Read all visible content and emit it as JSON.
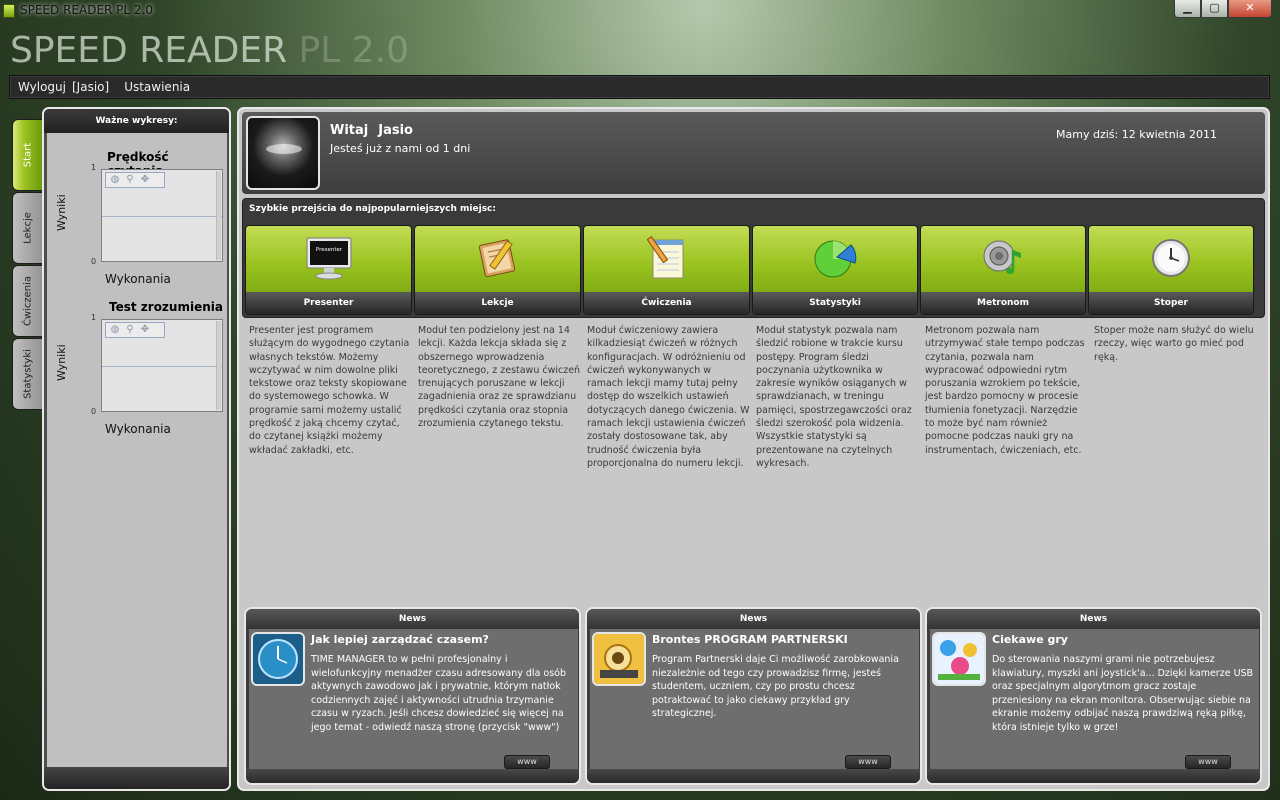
{
  "window": {
    "title": "SPEED READER PL 2.0",
    "controls": {
      "minimize": "▁",
      "maximize": "▢",
      "close": "✕"
    }
  },
  "brand": {
    "main": "SPEED READER",
    "version": "PL 2.0"
  },
  "menu": {
    "items": [
      "Wyloguj",
      "[Jasio]",
      "Ustawienia"
    ]
  },
  "side_tabs": [
    {
      "label": "Start",
      "active": true
    },
    {
      "label": "Lekcje",
      "active": false
    },
    {
      "label": "Ćwiczenia",
      "active": false
    },
    {
      "label": "Statystyki",
      "active": false
    }
  ],
  "left_panel": {
    "header": "Ważne wykresy:",
    "charts": [
      {
        "title": "Prędkość czytania",
        "ylabel": "Wyniki",
        "xlabel": "Wykonania",
        "y_ticks": [
          "1",
          "0"
        ]
      },
      {
        "title": "Test zrozumienia",
        "ylabel": "Wyniki",
        "xlabel": "Wykonania",
        "y_ticks": [
          "1",
          "0"
        ]
      }
    ]
  },
  "welcome": {
    "greeting": "Witaj",
    "user": "Jasio",
    "since": "Jesteś już z nami od 1 dni",
    "today": "Mamy dziś: 12 kwietnia 2011"
  },
  "quick": {
    "label": "Szybkie przejścia do najpopularniejszych miejsc:",
    "tiles": [
      {
        "name": "Presenter",
        "icon": "monitor-icon",
        "screen_text": "Presenter",
        "desc": "Presenter jest programem służącym do wygodnego czytania własnych tekstów. Możemy wczytywać w nim dowolne pliki tekstowe oraz teksty skopiowane do systemowego schowka. W programie sami możemy ustalić prędkość z jaką chcemy czytać, do czytanej książki możemy wkładać zakładki, etc."
      },
      {
        "name": "Lekcje",
        "icon": "book-pencil-icon",
        "desc": "Moduł ten podzielony jest na 14 lekcji. Każda lekcja składa się z obszernego wprowadzenia teoretycznego, z zestawu ćwiczeń trenujących poruszane w lekcji zagadnienia oraz ze sprawdzianu prędkości czytania oraz stopnia zrozumienia czytanego tekstu."
      },
      {
        "name": "Ćwiczenia",
        "icon": "notepad-icon",
        "desc": "Moduł ćwiczeniowy zawiera kilkadziesiąt ćwiczeń w różnych konfiguracjach. W odróżnieniu od ćwiczeń wykonywanych w ramach lekcji mamy tutaj pełny dostęp do wszelkich ustawień dotyczących danego ćwiczenia. W ramach lekcji ustawienia ćwiczeń zostały dostosowane tak, aby trudność ćwiczenia była proporcjonalna do numeru lekcji."
      },
      {
        "name": "Statystyki",
        "icon": "pie-chart-icon",
        "desc": "Moduł statystyk pozwala nam śledzić robione w trakcie kursu postępy. Program śledzi poczynania użytkownika w zakresie wyników osiąganych w sprawdzianach, w treningu pamięci, spostrzegawczości oraz śledzi szerokość pola widzenia. Wszystkie statystyki są prezentowane na czytelnych wykresach."
      },
      {
        "name": "Metronom",
        "icon": "speaker-note-icon",
        "desc": "Metronom pozwala nam utrzymywać stałe tempo podczas czytania, pozwala nam wypracować odpowiedni rytm poruszania wzrokiem po tekście, jest bardzo pomocny w procesie tłumienia fonetyzacji. Narzędzie to może być nam również pomocne podczas nauki gry na instrumentach, ćwiczeniach, etc."
      },
      {
        "name": "Stoper",
        "icon": "clock-icon",
        "desc": "Stoper może nam służyć do wielu rzeczy, więc warto go mieć pod ręką."
      }
    ]
  },
  "news": [
    {
      "header": "News",
      "thumb": "clock-thumb-icon",
      "title": "Jak lepiej zarządzać czasem?",
      "text": "TIME MANAGER to w pełni profesjonalny i wielofunkcyjny menadżer czasu adresowany dla osób aktywnych zawodowo jak i prywatnie, którym natłok codziennych zajęć i aktywności utrudnia trzymanie czasu w ryzach. Jeśli chcesz dowiedzieć się więcej na jego temat - odwiedź naszą stronę (przycisk \"www\")",
      "button": "www"
    },
    {
      "header": "News",
      "thumb": "partner-thumb-icon",
      "title": "Brontes PROGRAM PARTNERSKI",
      "text": "Program Partnerski daje Ci możliwość zarobkowania niezależnie od tego czy prowadzisz firmę, jesteś studentem, uczniem, czy po prostu chcesz potraktować to jako ciekawy przykład gry strategicznej.",
      "button": "www"
    },
    {
      "header": "News",
      "thumb": "games-thumb-icon",
      "title": "Ciekawe gry",
      "text": "Do sterowania naszymi grami nie potrzebujesz klawiatury, myszki ani joystick'a... Dzięki kamerze USB oraz specjalnym algorytmom gracz zostaje przeniesiony na ekran monitora. Obserwując siebie na ekranie możemy odbijać naszą prawdziwą ręką piłkę, która istnieje tylko w grze!",
      "button": "www"
    }
  ],
  "colors": {
    "accent": "#98c21e",
    "panel": "#c8c8c8",
    "dark": "#3a3a3a"
  }
}
